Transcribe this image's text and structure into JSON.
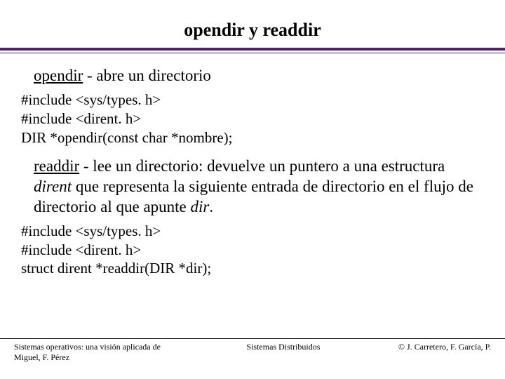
{
  "title": "opendir y readdir",
  "sections": [
    {
      "fn": "opendir",
      "desc_plain": " - abre un directorio",
      "code": [
        "#include <sys/types. h>",
        "#include <dirent. h>",
        "DIR *opendir(const char *nombre);"
      ]
    },
    {
      "fn": "readdir",
      "desc_parts": {
        "a": " - lee un directorio: devuelve un puntero a una estructura ",
        "it1": "dirent",
        "b": " que representa la siguiente entrada de directorio en el flujo de directorio al que apunte ",
        "it2": "dir",
        "c": "."
      },
      "code": [
        "#include <sys/types. h>",
        "#include <dirent. h>",
        "struct dirent *readdir(DIR *dir);"
      ]
    }
  ],
  "footer": {
    "left": "Sistemas operativos: una visión aplicada de Miguel, F. Pérez",
    "center": "Sistemas Distribuidos",
    "right": "© J. Carretero, F. García, P."
  }
}
